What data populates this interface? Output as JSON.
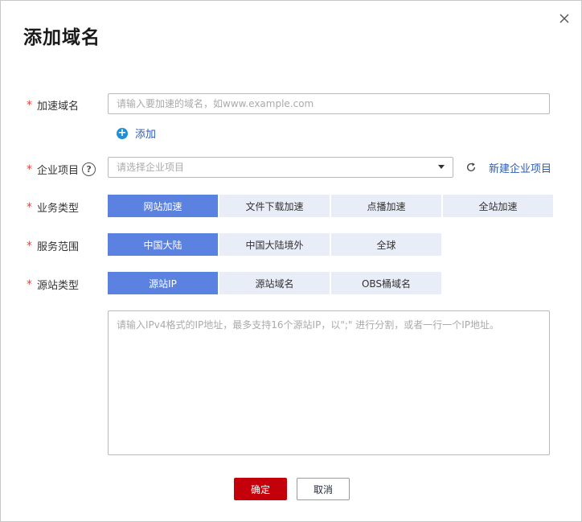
{
  "dialog": {
    "title": "添加域名",
    "close_icon": "close-icon"
  },
  "domain": {
    "label": "加速域名",
    "placeholder": "请输入要加速的域名，如www.example.com",
    "add_label": "添加"
  },
  "project": {
    "label": "企业项目",
    "placeholder": "请选择企业项目",
    "new_label": "新建企业项目"
  },
  "business_type": {
    "label": "业务类型",
    "options": [
      "网站加速",
      "文件下载加速",
      "点播加速",
      "全站加速"
    ],
    "selected": "网站加速"
  },
  "service_scope": {
    "label": "服务范围",
    "options": [
      "中国大陆",
      "中国大陆境外",
      "全球"
    ],
    "selected": "中国大陆"
  },
  "origin_type": {
    "label": "源站类型",
    "options": [
      "源站IP",
      "源站域名",
      "OBS桶域名"
    ],
    "selected": "源站IP"
  },
  "origin_input": {
    "placeholder": "请输入IPv4格式的IP地址，最多支持16个源站IP，以\";\" 进行分割，或者一行一个IP地址。"
  },
  "footer": {
    "confirm": "确定",
    "cancel": "取消"
  },
  "colors": {
    "accent": "#5b82e0",
    "primary_button": "#c4000a",
    "link": "#2b5cb8",
    "required": "#e54545"
  }
}
